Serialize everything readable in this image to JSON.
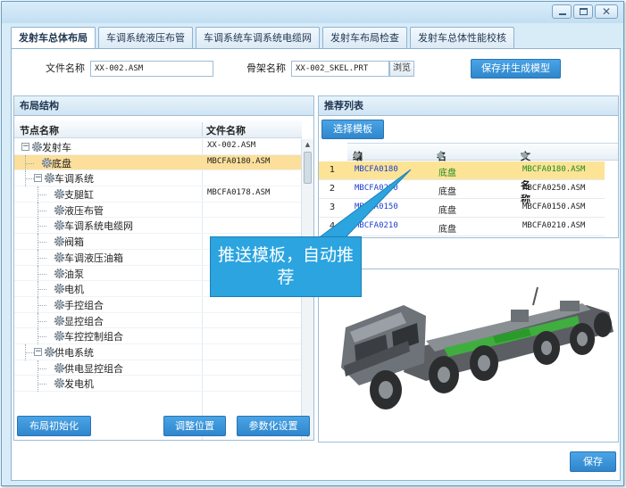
{
  "tabs": [
    {
      "label": "发射车总体布局",
      "active": true
    },
    {
      "label": "车调系统液压布管",
      "active": false
    },
    {
      "label": "车调系统车调系统电缆网",
      "active": false
    },
    {
      "label": "发射车布局检查",
      "active": false
    },
    {
      "label": "发射车总体性能校核",
      "active": false
    }
  ],
  "form": {
    "file_name_label": "文件名称",
    "file_name_value": "XX-002.ASM",
    "skeleton_label": "骨架名称",
    "skeleton_value": "XX-002_SKEL.PRT",
    "browse_label": "浏览",
    "save_generate_label": "保存并生成模型"
  },
  "layout_panel": {
    "title": "布局结构",
    "col_node": "节点名称",
    "col_file": "文件名称",
    "tree": [
      {
        "label": "发射车",
        "file": "XX-002.ASM",
        "level": 0,
        "expander": "minus"
      },
      {
        "label": "底盘",
        "file": "MBCFA0180.ASM",
        "level": 1,
        "expander": "",
        "selected": true
      },
      {
        "label": "车调系统",
        "file": "",
        "level": 1,
        "expander": "minus"
      },
      {
        "label": "支腿缸",
        "file": "MBCFA0178.ASM",
        "level": 2,
        "expander": ""
      },
      {
        "label": "液压布管",
        "file": "",
        "level": 2,
        "expander": ""
      },
      {
        "label": "车调系统电缆网",
        "file": "",
        "level": 2,
        "expander": ""
      },
      {
        "label": "阀箱",
        "file": "",
        "level": 2,
        "expander": ""
      },
      {
        "label": "车调液压油箱",
        "file": "",
        "level": 2,
        "expander": ""
      },
      {
        "label": "油泵",
        "file": "",
        "level": 2,
        "expander": ""
      },
      {
        "label": "电机",
        "file": "",
        "level": 2,
        "expander": ""
      },
      {
        "label": "手控组合",
        "file": "",
        "level": 2,
        "expander": ""
      },
      {
        "label": "显控组合",
        "file": "",
        "level": 2,
        "expander": ""
      },
      {
        "label": "车控控制组合",
        "file": "",
        "level": 2,
        "expander": ""
      },
      {
        "label": "供电系统",
        "file": "",
        "level": 1,
        "expander": "minus"
      },
      {
        "label": "供电显控组合",
        "file": "",
        "level": 2,
        "expander": ""
      },
      {
        "label": "发电机",
        "file": "",
        "level": 2,
        "expander": ""
      }
    ],
    "btn_init": "布局初始化",
    "btn_adjust": "调整位置",
    "btn_param": "参数化设置"
  },
  "recommend_panel": {
    "title": "推荐列表",
    "select_template_label": "选择模板",
    "col_code": "编号",
    "col_name": "名称",
    "col_file": "文件名称",
    "rows": [
      {
        "num": "1",
        "code": "MBCFA0180",
        "name": "底盘",
        "file": "MBCFA0180.ASM",
        "selected": true
      },
      {
        "num": "2",
        "code": "MBCFA0250",
        "name": "底盘",
        "file": "MBCFA0250.ASM"
      },
      {
        "num": "3",
        "code": "MBCFA0150",
        "name": "底盘",
        "file": "MBCFA0150.ASM"
      },
      {
        "num": "4",
        "code": "MBCFA0210",
        "name": "底盘",
        "file": "MBCFA0210.ASM"
      }
    ]
  },
  "callout_text": "推送模板，自动推荐",
  "save_label": "保存",
  "colors": {
    "accent": "#2f86cc",
    "selected_row": "#fce396",
    "callout": "#2ba4e0",
    "code_blue": "#1a3fd0",
    "highlight_green": "#1e8c1e"
  }
}
